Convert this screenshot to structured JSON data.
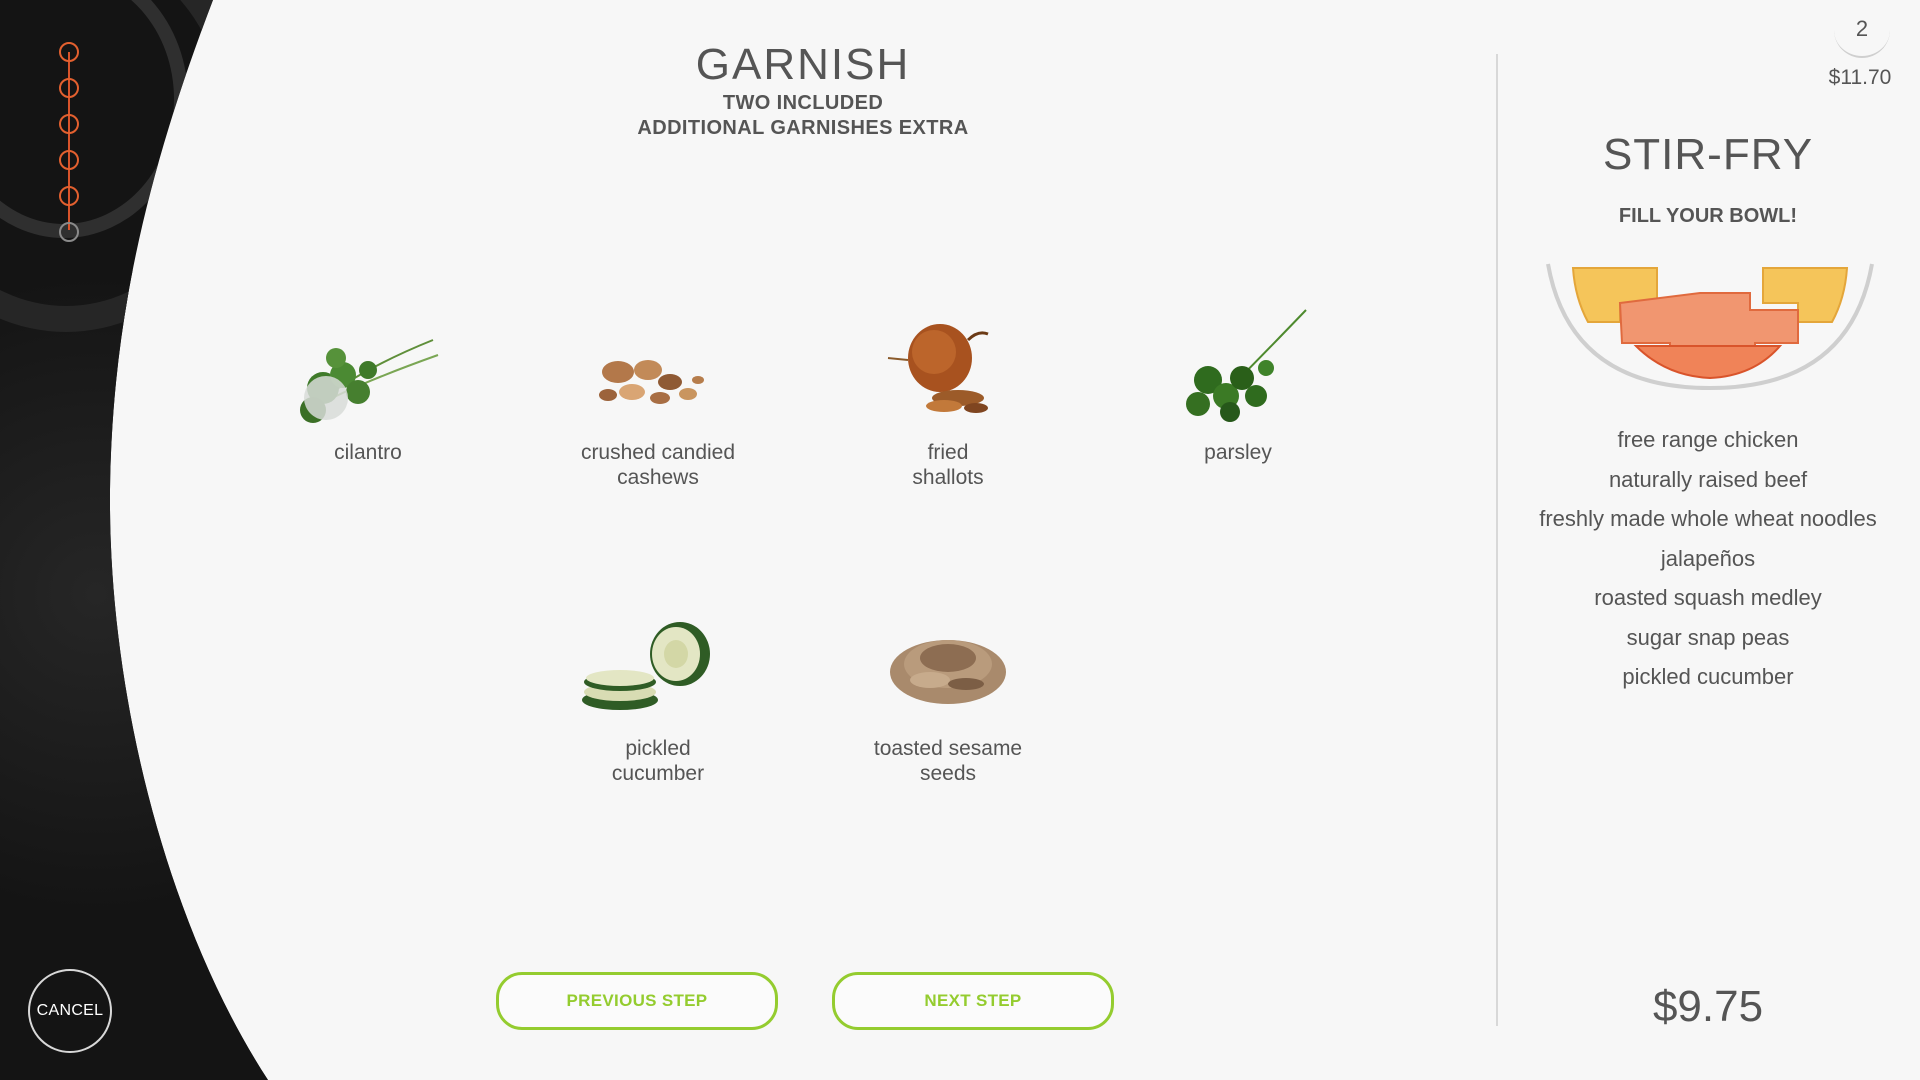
{
  "stepper": {
    "steps": [
      "done",
      "done",
      "done",
      "done",
      "done",
      "pending"
    ]
  },
  "cancel_label": "CANCEL",
  "header": {
    "title": "GARNISH",
    "line1": "TWO INCLUDED",
    "line2": "ADDITIONAL GARNISHES EXTRA"
  },
  "garnishes": [
    {
      "label": "cilantro",
      "icon": "cilantro-icon"
    },
    {
      "label": "crushed candied cashews",
      "icon": "cashews-icon"
    },
    {
      "label": "fried shallots",
      "icon": "shallots-icon"
    },
    {
      "label": "parsley",
      "icon": "parsley-icon"
    },
    {
      "label": "pickled cucumber",
      "icon": "cucumber-icon"
    },
    {
      "label": "toasted sesame seeds",
      "icon": "sesame-icon"
    }
  ],
  "buttons": {
    "previous": "PREVIOUS STEP",
    "next": "NEXT STEP"
  },
  "cart": {
    "count": "2",
    "total": "$11.70"
  },
  "summary": {
    "title": "STIR-FRY",
    "subtitle": "FILL YOUR BOWL!",
    "ingredients": [
      "free range chicken",
      "naturally raised beef",
      "freshly made whole wheat noodles",
      "jalapeños",
      "roasted squash medley",
      "sugar snap peas",
      "pickled cucumber"
    ],
    "price": "$9.75"
  },
  "colors": {
    "accent_orange": "#e3602f",
    "accent_green": "#94cc2f"
  }
}
